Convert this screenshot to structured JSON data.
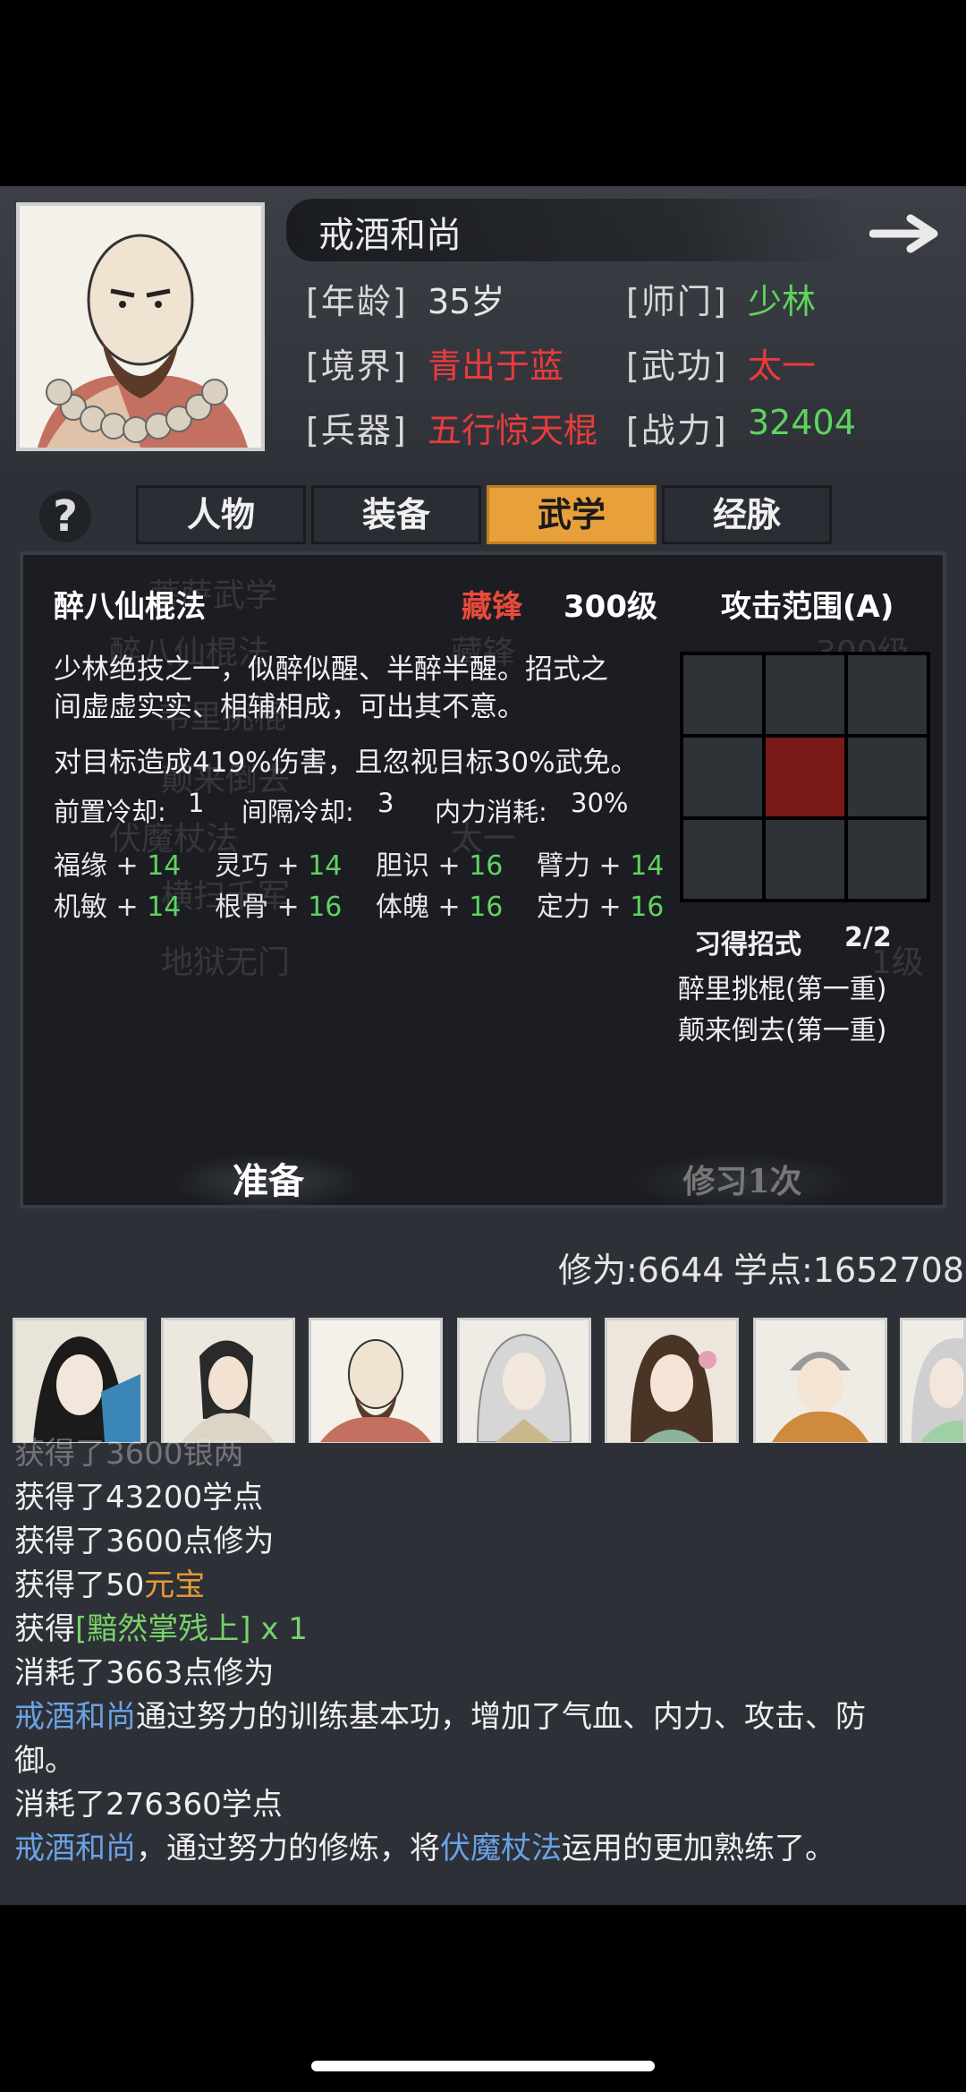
{
  "hero": {
    "name": "戒酒和尚",
    "rows": [
      {
        "label": "[年龄]",
        "value": "35岁"
      },
      {
        "label": "[境界]",
        "value": "青出于蓝"
      },
      {
        "label": "[兵器]",
        "value": "五行惊天棍"
      }
    ],
    "rows_right": [
      {
        "label": "[师门]",
        "value": "少林"
      },
      {
        "label": "[武功]",
        "value": "太一"
      },
      {
        "label": "[战力]",
        "value": "32404"
      }
    ]
  },
  "tabs": [
    "人物",
    "装备",
    "武学",
    "经脉"
  ],
  "active_tab": "武学",
  "help_label": "?",
  "skill": {
    "name": "醉八仙棍法",
    "state": "藏锋",
    "level": "300级",
    "range_title": "攻击范围(A)",
    "desc": "少林绝技之一，似醉似醒、半醉半醒。招式之间虚虚实实、相辅相成，可出其不意。",
    "desc_line1": "少林绝技之一，似醉似醒、半醉半醒。招式之",
    "desc_line2": "间虚虚实实、相辅相成，可出其不意。",
    "effect": "对目标造成419%伤害，且忽视目标30%武免。",
    "cd_label": "前置冷却:",
    "cd_value": "1",
    "interval_label": "间隔冷却:",
    "interval_value": "3",
    "mp_label": "内力消耗:",
    "mp_value": "30%",
    "bonuses": [
      {
        "attr": "福缘",
        "value": "14"
      },
      {
        "attr": "灵巧",
        "value": "14"
      },
      {
        "attr": "胆识",
        "value": "16"
      },
      {
        "attr": "臂力",
        "value": "14"
      },
      {
        "attr": "机敏",
        "value": "14"
      },
      {
        "attr": "根骨",
        "value": "16"
      },
      {
        "attr": "体魄",
        "value": "16"
      },
      {
        "attr": "定力",
        "value": "16"
      }
    ],
    "learned_label": "习得招式",
    "learned_count": "2/2",
    "moves": [
      "醉里挑棍(第一重)",
      "颠来倒去(第一重)"
    ],
    "range_grid": [
      0,
      0,
      0,
      0,
      1,
      0,
      0,
      0,
      0
    ]
  },
  "ghost_text": [
    "菩萨武学",
    "醉八仙棍法",
    "韦里挑棍",
    "颠来倒去",
    "伏魔杖法",
    "横扫千军",
    "地狱无门",
    "藏锋",
    "太一",
    "300级",
    "1级"
  ],
  "buttons": {
    "prepare": "准备",
    "practice": "修习1次"
  },
  "stats": {
    "cultivation": "修为:6644",
    "points": "学点:1652708"
  },
  "log": [
    {
      "parts": [
        {
          "t": "获得了3600银两",
          "c": ""
        }
      ]
    },
    {
      "parts": [
        {
          "t": "获得了43200学点",
          "c": ""
        }
      ]
    },
    {
      "parts": [
        {
          "t": "获得了3600点修为",
          "c": ""
        }
      ]
    },
    {
      "parts": [
        {
          "t": "获得了50",
          "c": ""
        },
        {
          "t": "元宝",
          "c": "orange"
        }
      ]
    },
    {
      "parts": [
        {
          "t": "获得",
          "c": ""
        },
        {
          "t": "[黯然掌残上]",
          "c": "lgreen"
        },
        {
          "t": " x 1",
          "c": "lgreen"
        }
      ]
    },
    {
      "parts": [
        {
          "t": "消耗了3663点修为",
          "c": ""
        }
      ]
    },
    {
      "parts": [
        {
          "t": "戒酒和尚",
          "c": "blue"
        },
        {
          "t": "通过努力的训练基本功，增加了气血、内力、攻击、防",
          "c": ""
        }
      ]
    },
    {
      "parts": [
        {
          "t": "御。",
          "c": ""
        }
      ]
    },
    {
      "parts": [
        {
          "t": "消耗了276360学点",
          "c": ""
        }
      ]
    },
    {
      "parts": [
        {
          "t": "戒酒和尚",
          "c": "blue"
        },
        {
          "t": "，通过努力的修炼，将",
          "c": ""
        },
        {
          "t": "伏魔杖法",
          "c": "blue"
        },
        {
          "t": "运用的更加熟练了。",
          "c": ""
        }
      ]
    }
  ]
}
